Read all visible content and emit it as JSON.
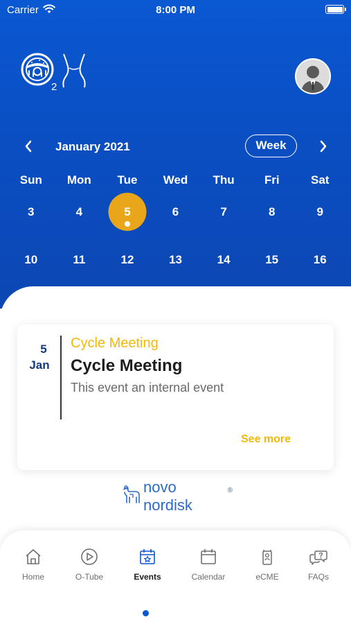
{
  "status_bar": {
    "carrier": "Carrier",
    "time": "8:00 PM"
  },
  "calendar": {
    "month_title": "January 2021",
    "view_toggle": "Week",
    "weekdays": [
      "Sun",
      "Mon",
      "Tue",
      "Wed",
      "Thu",
      "Fri",
      "Sat"
    ],
    "weeks": [
      [
        "3",
        "4",
        "5",
        "6",
        "7",
        "8",
        "9"
      ],
      [
        "10",
        "11",
        "12",
        "13",
        "14",
        "15",
        "16"
      ]
    ],
    "selected_date": "5"
  },
  "event": {
    "day": "5",
    "month": "Jan",
    "type": "Cycle Meeting",
    "title": "Cycle Meeting",
    "description": "This event an internal event",
    "see_more": "See more"
  },
  "brand": {
    "name": "novo nordisk",
    "mark": "®"
  },
  "tabs": [
    {
      "label": "Home",
      "icon": "home-icon"
    },
    {
      "label": "O-Tube",
      "icon": "play-icon"
    },
    {
      "label": "Events",
      "icon": "calendar-star-icon",
      "active": true
    },
    {
      "label": "Calendar",
      "icon": "calendar-icon"
    },
    {
      "label": "eCME",
      "icon": "badge-icon"
    },
    {
      "label": "FAQs",
      "icon": "chat-question-icon"
    }
  ],
  "colors": {
    "header_blue": "#0a4fc4",
    "selected_date": "#e9a61a",
    "event_accent": "#f2b90c",
    "date_navy": "#143a80",
    "brand_blue": "#2d6bc4"
  }
}
